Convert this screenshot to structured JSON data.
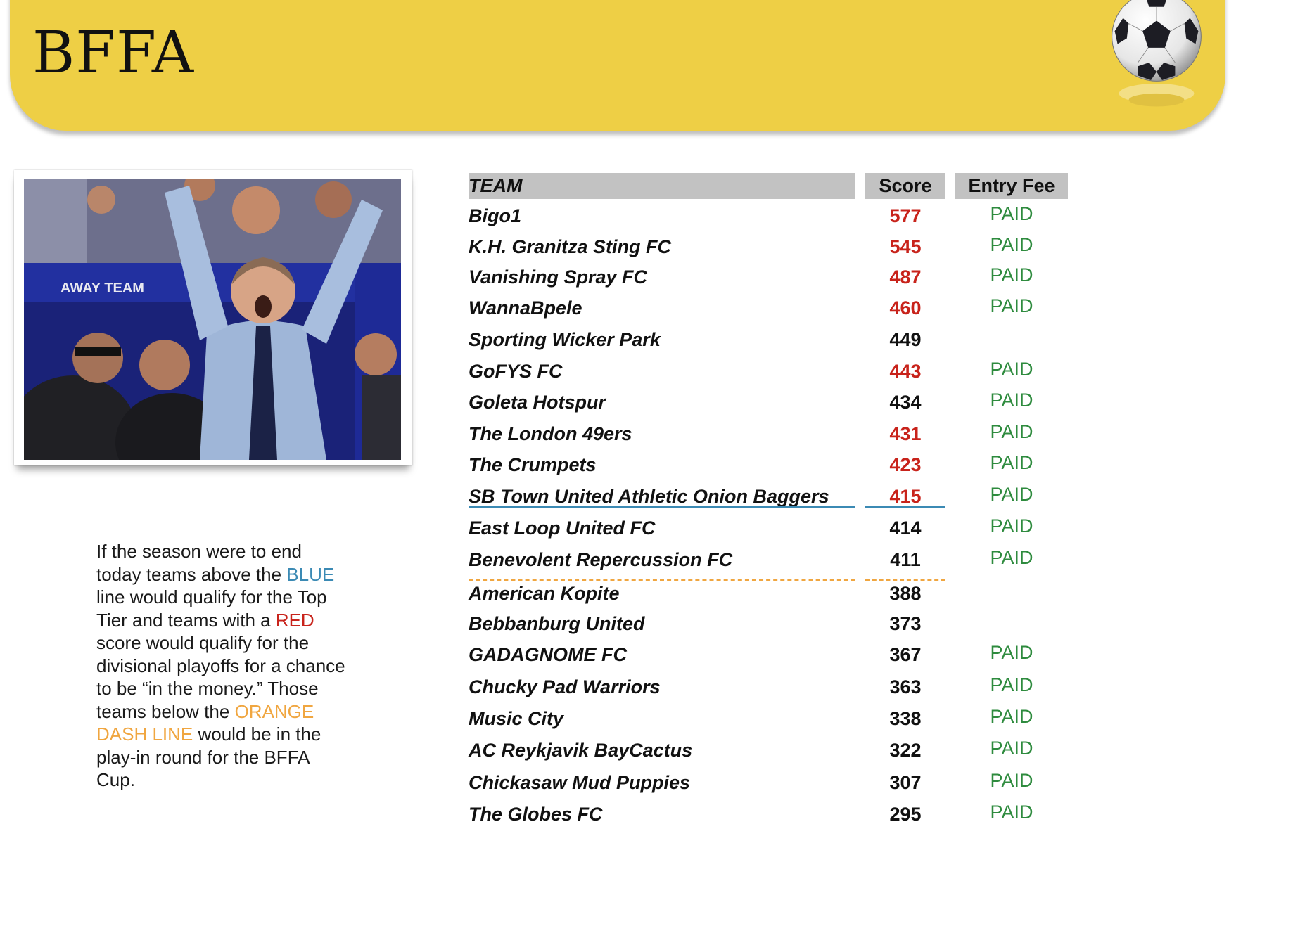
{
  "header": {
    "title": "BFFA"
  },
  "photo": {
    "caption_visible": "AWAY TEAM"
  },
  "note": {
    "part1": "If the season were to end today teams above the ",
    "blue_word": "BLUE",
    "part2": " line would qualify for the Top Tier and teams with a ",
    "red_word": "RED",
    "part3": " score would qualify for the divisional playoffs for a chance to be “in the money.” Those teams below the ",
    "orange_word": "ORANGE DASH LINE",
    "part4": " would be in the play-in round for the BFFA Cup."
  },
  "table": {
    "headers": {
      "team": "TEAM",
      "score": "Score",
      "fee": "Entry Fee"
    },
    "rows": [
      {
        "team": "Bigo1",
        "score": "577",
        "red": true,
        "fee": "PAID"
      },
      {
        "team": "K.H. Granitza Sting FC",
        "score": "545",
        "red": true,
        "fee": "PAID"
      },
      {
        "team": "Vanishing Spray FC",
        "score": "487",
        "red": true,
        "fee": "PAID"
      },
      {
        "team": "WannaBpele",
        "score": "460",
        "red": true,
        "fee": "PAID"
      },
      {
        "team": "Sporting Wicker Park",
        "score": "449",
        "red": false,
        "fee": ""
      },
      {
        "team": "GoFYS FC",
        "score": "443",
        "red": true,
        "fee": "PAID"
      },
      {
        "team": "Goleta Hotspur",
        "score": "434",
        "red": false,
        "fee": "PAID"
      },
      {
        "team": "The London 49ers",
        "score": "431",
        "red": true,
        "fee": "PAID"
      },
      {
        "team": "The Crumpets",
        "score": "423",
        "red": true,
        "fee": "PAID"
      },
      {
        "team": "SB Town United Athletic Onion Baggers",
        "score": "415",
        "red": true,
        "fee": "PAID"
      },
      {
        "team": "East Loop United FC",
        "score": "414",
        "red": false,
        "fee": "PAID"
      },
      {
        "team": "Benevolent Repercussion FC",
        "score": "411",
        "red": false,
        "fee": "PAID"
      },
      {
        "team": "American Kopite",
        "score": "388",
        "red": false,
        "fee": ""
      },
      {
        "team": "Bebbanburg United",
        "score": "373",
        "red": false,
        "fee": ""
      },
      {
        "team": "GADAGNOME FC",
        "score": "367",
        "red": false,
        "fee": "PAID"
      },
      {
        "team": "Chucky Pad Warriors",
        "score": "363",
        "red": false,
        "fee": "PAID"
      },
      {
        "team": "Music City",
        "score": "338",
        "red": false,
        "fee": "PAID"
      },
      {
        "team": "AC Reykjavik BayCactus",
        "score": "322",
        "red": false,
        "fee": "PAID"
      },
      {
        "team": "Chickasaw Mud Puppies",
        "score": "307",
        "red": false,
        "fee": "PAID"
      },
      {
        "team": "The Globes FC",
        "score": "295",
        "red": false,
        "fee": "PAID"
      }
    ]
  },
  "colors": {
    "banner": "#eecf45",
    "score_red": "#c8231b",
    "paid_green": "#2e8b3e",
    "blue_line": "#3b8ab4",
    "orange_line": "#f0a640"
  }
}
